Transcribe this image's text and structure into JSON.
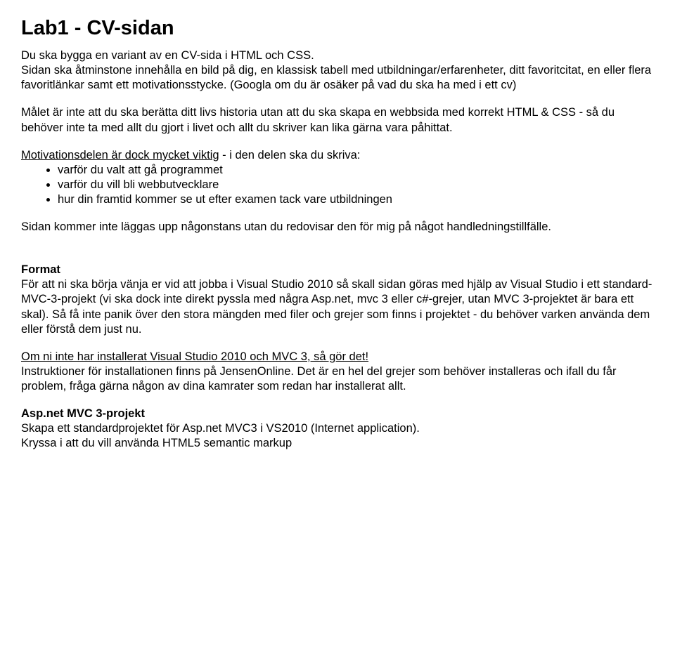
{
  "title": "Lab1 - CV-sidan",
  "intro": "Du ska bygga en variant av en CV-sida i HTML och CSS.\nSidan ska åtminstone innehålla en bild på dig, en klassisk tabell med utbildningar/erfarenheter, ditt favoritcitat, en eller flera favoritlänkar samt ett motivationsstycke. (Googla om du är osäker på vad du ska ha med i ett cv)",
  "goal": "Målet är inte att du ska berätta ditt livs historia utan att du ska skapa en webbsida med korrekt HTML & CSS - så du behöver inte ta med allt du gjort i livet och allt du skriver kan lika gärna vara påhittat.",
  "motivation_lead_underlined": "Motivationsdelen är dock mycket viktig",
  "motivation_lead_rest": " - i den delen ska du skriva:",
  "motivation_items": [
    "varför du valt att gå programmet",
    "varför du vill bli webbutvecklare",
    "hur din framtid kommer se ut efter examen tack vare utbildningen"
  ],
  "publish_note": "Sidan kommer inte läggas upp någonstans utan du redovisar den för mig på något handledningstillfälle.",
  "format_heading": "Format",
  "format_body": "För att ni ska börja vänja er vid att jobba i Visual Studio 2010 så skall sidan göras med hjälp av Visual Studio i ett standard-MVC-3-projekt (vi ska dock inte direkt pyssla med några Asp.net, mvc 3 eller c#-grejer, utan MVC 3-projektet är bara ett skal). Så få inte panik över den stora mängden med filer och grejer som finns i projektet - du behöver varken använda dem eller förstå dem just nu.",
  "install_underlined": "Om ni inte har installerat Visual Studio 2010 och MVC 3, så gör det!",
  "install_rest": "Instruktioner för installationen finns på JensenOnline. Det är en hel del grejer som behöver installeras och ifall du får problem, fråga gärna någon av dina kamrater som redan har installerat allt.",
  "project_heading": "Asp.net MVC 3-projekt",
  "project_line1": "Skapa ett standardprojektet för Asp.net MVC3 i VS2010 (Internet application).",
  "project_line2": "Kryssa i att du vill använda HTML5 semantic markup"
}
